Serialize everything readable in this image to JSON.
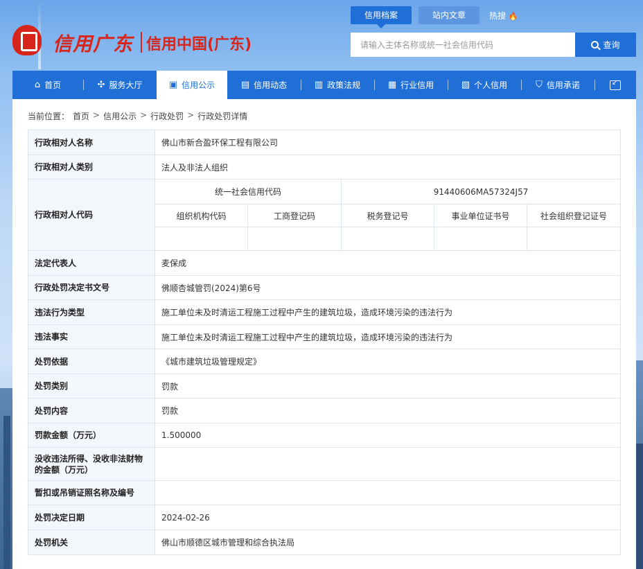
{
  "header": {
    "logo_left": "信用广东",
    "logo_right": "信用中国(广东)",
    "top_tabs": [
      "信用档案",
      "站内文章"
    ],
    "hot_label": "热搜",
    "search": {
      "placeholder": "请输入主体名称或统一社会信用代码",
      "button": "查询"
    }
  },
  "nav": {
    "items": [
      {
        "label": "首页",
        "icon": "home-icon"
      },
      {
        "label": "服务大厅",
        "icon": "grid-icon"
      },
      {
        "label": "信用公示",
        "icon": "display-icon"
      },
      {
        "label": "信用动态",
        "icon": "doc-icon"
      },
      {
        "label": "政策法规",
        "icon": "book-icon"
      },
      {
        "label": "行业信用",
        "icon": "building-icon"
      },
      {
        "label": "个人信用",
        "icon": "id-card-icon"
      },
      {
        "label": "信用承诺",
        "icon": "shield-icon"
      }
    ],
    "active": "信用公示"
  },
  "breadcrumb": {
    "prefix": "当前位置：",
    "items": [
      "首页",
      "信用公示",
      "行政处罚",
      "行政处罚详情"
    ]
  },
  "detail": {
    "name_label": "行政相对人名称",
    "name_value": "佛山市新合盈环保工程有限公司",
    "type_label": "行政相对人类别",
    "type_value": "法人及非法人组织",
    "code_label": "行政相对人代码",
    "uscc_label": "统一社会信用代码",
    "uscc_value": "91440606MA57324J57",
    "sub_codes": [
      "组织机构代码",
      "工商登记码",
      "税务登记号",
      "事业单位证书号",
      "社会组织登记证号"
    ],
    "sub_values": [
      "",
      "",
      "",
      "",
      ""
    ],
    "rows": [
      {
        "label": "法定代表人",
        "value": "麦保成"
      },
      {
        "label": "行政处罚决定书文号",
        "value": "佛顺杏城管罚(2024)第6号"
      },
      {
        "label": "违法行为类型",
        "value": "施工单位未及时清运工程施工过程中产生的建筑垃圾，造成环境污染的违法行为"
      },
      {
        "label": "违法事实",
        "value": "施工单位未及时清运工程施工过程中产生的建筑垃圾，造成环境污染的违法行为"
      },
      {
        "label": "处罚依据",
        "value": "《城市建筑垃圾管理规定》"
      },
      {
        "label": "处罚类别",
        "value": "罚款"
      },
      {
        "label": "处罚内容",
        "value": "罚款"
      },
      {
        "label": "罚款金额（万元）",
        "value": "1.500000"
      },
      {
        "label": "没收违法所得、没收非法财物的金额（万元）",
        "value": ""
      },
      {
        "label": "暂扣或吊销证照名称及编号",
        "value": ""
      },
      {
        "label": "处罚决定日期",
        "value": "2024-02-26"
      },
      {
        "label": "处罚机关",
        "value": "佛山市顺德区城市管理和综合执法局"
      }
    ]
  },
  "colors": {
    "primary": "#1f6fd6",
    "brand_red": "#d8251b",
    "label_bg": "#f3f6fa",
    "border": "#dde4ee"
  }
}
